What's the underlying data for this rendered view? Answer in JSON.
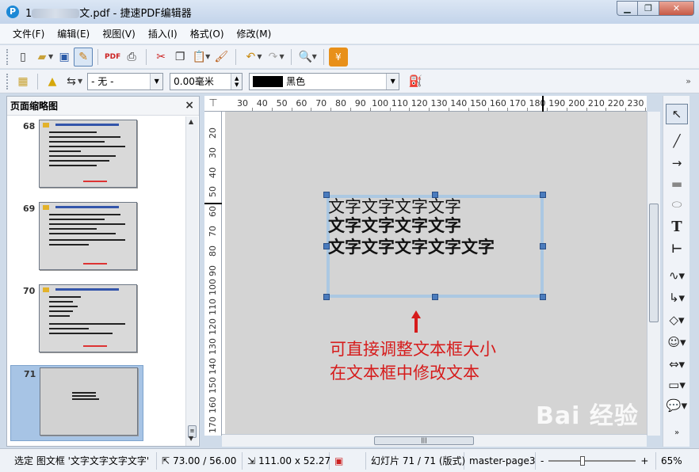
{
  "window": {
    "title_prefix": "1",
    "title_suffix": "文.pdf - 捷速PDF编辑器",
    "app_icon": "P"
  },
  "menu": [
    "文件(F)",
    "编辑(E)",
    "视图(V)",
    "插入(I)",
    "格式(O)",
    "修改(M)"
  ],
  "toolbar2": {
    "line_style": "- 无 -",
    "line_width": "0.00毫米",
    "color_name": "黑色",
    "color_hex": "#000000"
  },
  "thumb_panel": {
    "title": "页面缩略图",
    "pages": [
      "68",
      "69",
      "70",
      "71"
    ],
    "selected": "71"
  },
  "hruler": [
    "30",
    "40",
    "50",
    "60",
    "70",
    "80",
    "90",
    "100",
    "110",
    "120",
    "130",
    "140",
    "150",
    "160",
    "170",
    "180",
    "190",
    "200",
    "210",
    "220",
    "230"
  ],
  "vruler": [
    "20",
    "30",
    "40",
    "50",
    "60",
    "70",
    "80",
    "90",
    "100",
    "110",
    "120",
    "130",
    "140",
    "150",
    "160",
    "170"
  ],
  "textbox": {
    "lines": [
      "文字文字文字文字",
      "文字文字文字文字",
      "文字文字文字文字文字"
    ]
  },
  "annotation": {
    "line1": "可直接调整文本框大小",
    "line2": "在文本框中修改文本",
    "color": "#d61b1b"
  },
  "status": {
    "selection": "选定 图文框 '文字文字文字文字'",
    "position": "73.00 / 56.00",
    "size": "111.00 x 52.27",
    "slide": "幻灯片 71 / 71 (版式)",
    "master": "master-page3",
    "zoom_minus": "-",
    "zoom_plus": "+",
    "zoom": "65%"
  },
  "watermark": "Bai 经验"
}
